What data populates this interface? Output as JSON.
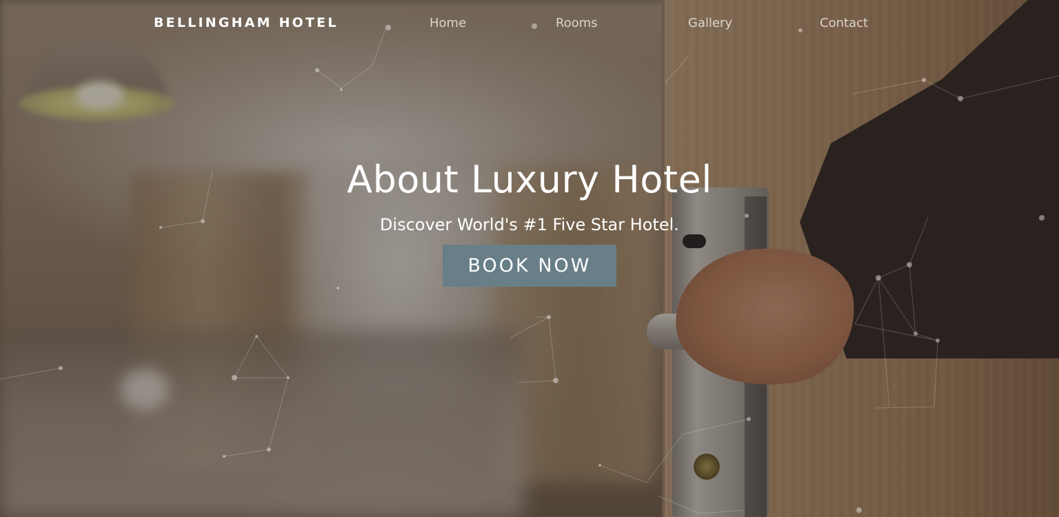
{
  "nav": {
    "brand": "BELLINGHAM HOTEL",
    "links": [
      {
        "label": "Home"
      },
      {
        "label": "Rooms"
      },
      {
        "label": "Gallery"
      },
      {
        "label": "Contact"
      }
    ]
  },
  "hero": {
    "title": "About Luxury Hotel",
    "subtitle": "Discover World's #1 Five Star Hotel.",
    "cta_label": "BOOK NOW",
    "background_image": "hotel-door-hand-photo",
    "overlay_effect": "particle-network"
  },
  "colors": {
    "button_bg": "#687f87",
    "title_text": "#ffffff",
    "nav_text": "#ece7df"
  }
}
